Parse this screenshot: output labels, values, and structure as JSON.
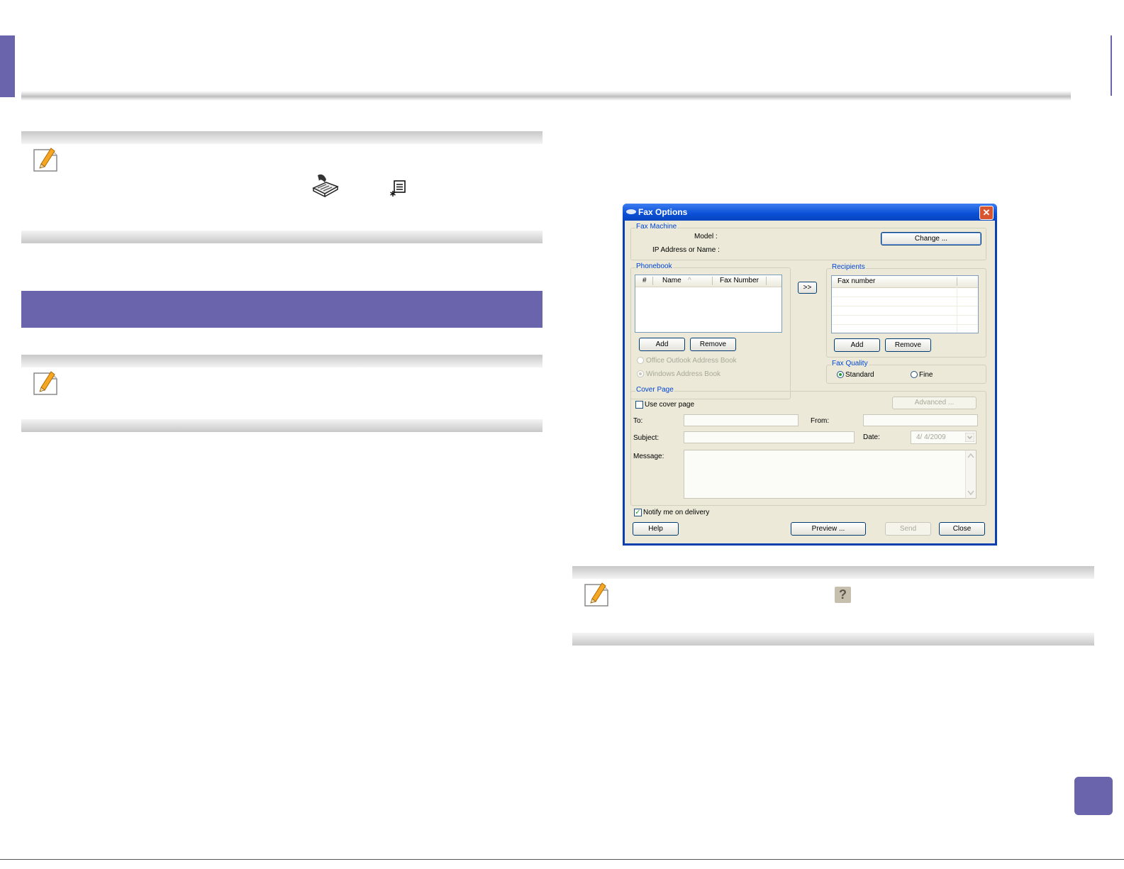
{
  "dialog": {
    "title": "Fax Options",
    "close_glyph": "✕",
    "fax_machine": {
      "group_label": "Fax Machine",
      "model_label": "Model :",
      "ip_label": "IP Address or Name :",
      "change_button": "Change ..."
    },
    "phonebook": {
      "group_label": "Phonebook",
      "columns": [
        "#",
        "Name",
        "Fax Number"
      ],
      "sort_indicator": "^",
      "add_button": "Add",
      "remove_button": "Remove",
      "option_outlook": "Office Outlook Address Book",
      "option_windows": "Windows Address Book"
    },
    "transfer_button": ">>",
    "recipients": {
      "group_label": "Recipients",
      "column": "Fax number",
      "add_button": "Add",
      "remove_button": "Remove"
    },
    "fax_quality": {
      "group_label": "Fax Quality",
      "standard": "Standard",
      "fine": "Fine",
      "selected": "Standard"
    },
    "cover_page": {
      "group_label": "Cover Page",
      "use_cover_page": "Use cover page",
      "advanced_button": "Advanced ...",
      "to_label": "To:",
      "from_label": "From:",
      "subject_label": "Subject:",
      "date_label": "Date:",
      "date_value": "4/ 4/2009",
      "message_label": "Message:"
    },
    "notify_label": "Notify me on delivery",
    "notify_checked": true,
    "buttons": {
      "help": "Help",
      "preview": "Preview ...",
      "send": "Send",
      "close": "Close"
    }
  },
  "note_icons": [
    "pencil-note-icon",
    "fax-machine-icon",
    "menu-settings-icon",
    "help-question-icon"
  ],
  "help_glyph": "?",
  "colors": {
    "accent_purple": "#6a64ad",
    "xp_title_blue": "#0a4fd6",
    "group_label_blue": "#0046d5"
  }
}
